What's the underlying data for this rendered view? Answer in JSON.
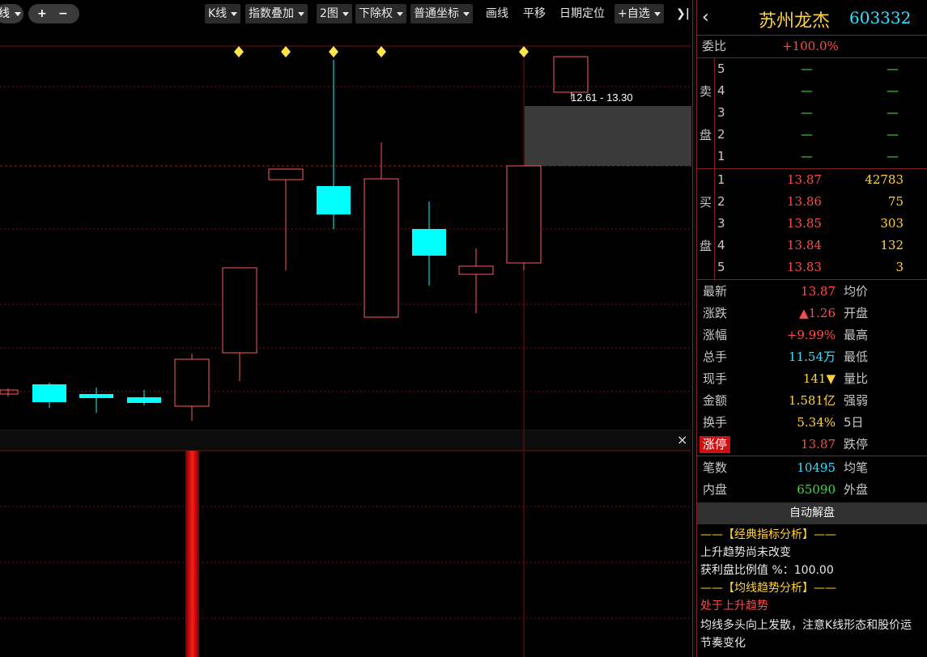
{
  "toolbar": {
    "left_pill_label": "线",
    "zoom_in": "+",
    "zoom_out": "−",
    "items": [
      "K线",
      "指数叠加",
      "2图",
      "下除权",
      "普通坐标"
    ],
    "plain_items": [
      "画线",
      "平移",
      "日期定位"
    ],
    "watchlist": "+自选",
    "collapse": "❯|"
  },
  "chart": {
    "range_label": "12.61 - 13.30",
    "sub_close": "×"
  },
  "colors": {
    "up": "#ff5a5a",
    "down": "#00ffff",
    "grid": "#7a1010",
    "marker": "#ffe44a",
    "volume": "#e00000"
  },
  "quote": {
    "back": "‹",
    "name": "苏州龙杰",
    "code": "603332",
    "weibi_label": "委比",
    "weibi_value": "+100.0%",
    "sell_label": [
      "卖",
      "盘"
    ],
    "buy_label": [
      "买",
      "盘"
    ],
    "sell": [
      {
        "level": "5",
        "price": "—",
        "volume": "—"
      },
      {
        "level": "4",
        "price": "—",
        "volume": "—"
      },
      {
        "level": "3",
        "price": "—",
        "volume": "—"
      },
      {
        "level": "2",
        "price": "—",
        "volume": "—"
      },
      {
        "level": "1",
        "price": "—",
        "volume": "—"
      }
    ],
    "buy": [
      {
        "level": "1",
        "price": "13.87",
        "volume": "42783"
      },
      {
        "level": "2",
        "price": "13.86",
        "volume": "75"
      },
      {
        "level": "3",
        "price": "13.85",
        "volume": "303"
      },
      {
        "level": "4",
        "price": "13.84",
        "volume": "132"
      },
      {
        "level": "5",
        "price": "13.83",
        "volume": "3"
      }
    ],
    "stats": [
      {
        "label": "最新",
        "value": "13.87",
        "color": "red",
        "label2": "均价"
      },
      {
        "label": "涨跌",
        "value": "▲1.26",
        "color": "red",
        "label2": "开盘"
      },
      {
        "label": "涨幅",
        "value": "+9.99%",
        "color": "red",
        "label2": "最高"
      },
      {
        "label": "总手",
        "value": "11.54万",
        "color": "cyan",
        "label2": "最低"
      },
      {
        "label": "现手",
        "value": "141▼",
        "color": "yellow",
        "label2": "量比"
      },
      {
        "label": "金额",
        "value": "1.581亿",
        "color": "yellow",
        "label2": "强弱"
      },
      {
        "label": "换手",
        "value": "5.34%",
        "color": "yellow",
        "label2": "5日"
      },
      {
        "label": "涨停",
        "value": "13.87",
        "color": "red",
        "label2": "跌停"
      },
      {
        "label": "笔数",
        "value": "10495",
        "color": "cyan",
        "label2": "均笔"
      },
      {
        "label": "内盘",
        "value": "65090",
        "color": "green",
        "label2": "外盘"
      }
    ],
    "analysis_button": "自动解盘",
    "analysis": [
      {
        "text": "——【经典指标分析】——",
        "color": "yellow"
      },
      {
        "text": "上升趋势尚未改变",
        "color": "white"
      },
      {
        "text": "获利盘比例值 %：100.00",
        "color": "white"
      },
      {
        "text": "——【均线趋势分析】——",
        "color": "yellow"
      },
      {
        "text": "处于上升趋势",
        "color": "red"
      },
      {
        "text": "均线多头向上发散，注意K线形态和股价运",
        "color": "white"
      },
      {
        "text": "节奏变化",
        "color": "white"
      }
    ]
  }
}
